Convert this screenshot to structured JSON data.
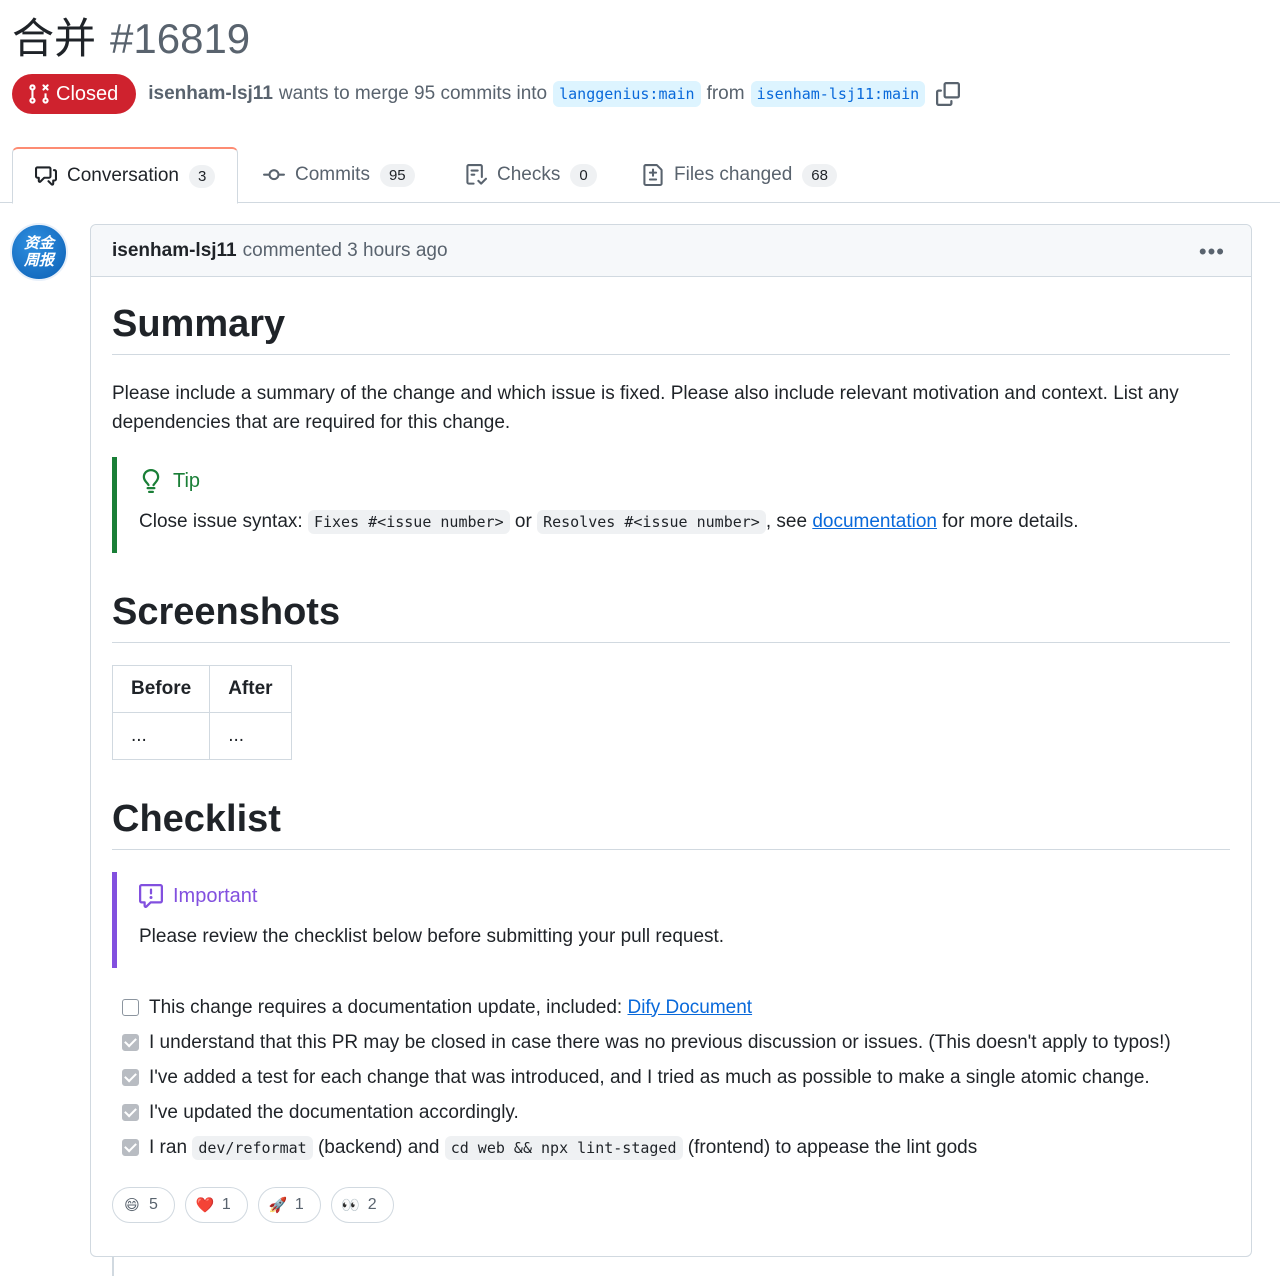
{
  "pr": {
    "title": "合并",
    "number": "#16819",
    "state": "Closed",
    "author": "isenham-lsj11",
    "merge_text": "wants to merge 95 commits into",
    "base_branch": "langgenius:main",
    "from_text": "from",
    "head_branch": "isenham-lsj11:main"
  },
  "tabs": [
    {
      "label": "Conversation",
      "count": "3",
      "icon": "comment-discussion-icon"
    },
    {
      "label": "Commits",
      "count": "95",
      "icon": "git-commit-icon"
    },
    {
      "label": "Checks",
      "count": "0",
      "icon": "checklist-icon"
    },
    {
      "label": "Files changed",
      "count": "68",
      "icon": "file-diff-icon"
    }
  ],
  "avatar": {
    "line1": "资金",
    "line2": "周报"
  },
  "comment": {
    "author": "isenham-lsj11",
    "meta": "commented 3 hours ago",
    "summary_heading": "Summary",
    "summary_text": "Please include a summary of the change and which issue is fixed. Please also include relevant motivation and context. List any dependencies that are required for this change.",
    "tip": {
      "title": "Tip",
      "prefix": "Close issue syntax:",
      "code1": "Fixes #<issue number>",
      "or": "or",
      "code2": "Resolves #<issue number>",
      "see": ", see",
      "link": "documentation",
      "suffix": "for more details."
    },
    "screenshots_heading": "Screenshots",
    "table": {
      "headers": [
        "Before",
        "After"
      ],
      "row": [
        "...",
        "..."
      ]
    },
    "checklist_heading": "Checklist",
    "important": {
      "title": "Important",
      "text": "Please review the checklist below before submitting your pull request."
    },
    "checklist": [
      {
        "checked": false,
        "text": "This change requires a documentation update, included:",
        "link": "Dify Document"
      },
      {
        "checked": true,
        "text": "I understand that this PR may be closed in case there was no previous discussion or issues. (This doesn't apply to typos!)"
      },
      {
        "checked": true,
        "text": "I've added a test for each change that was introduced, and I tried as much as possible to make a single atomic change."
      },
      {
        "checked": true,
        "text": "I've updated the documentation accordingly."
      }
    ],
    "last_item": {
      "checked": true,
      "pre": "I ran",
      "code1": "dev/reformat",
      "mid": "(backend) and",
      "code2": "cd web && npx lint-staged",
      "post": "(frontend) to appease the lint gods"
    },
    "reactions": [
      {
        "emoji": "😄",
        "count": "5"
      },
      {
        "emoji": "❤️",
        "count": "1"
      },
      {
        "emoji": "🚀",
        "count": "1"
      },
      {
        "emoji": "👀",
        "count": "2"
      }
    ]
  }
}
